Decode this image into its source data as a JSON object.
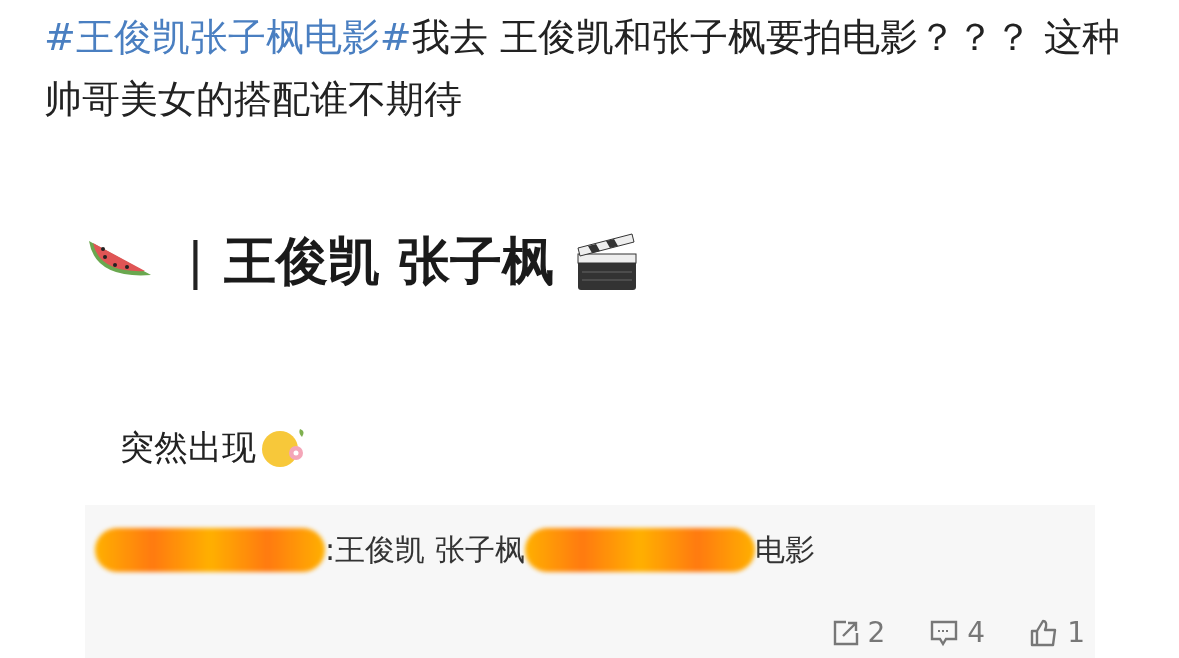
{
  "post": {
    "hashtag": "#王俊凯张子枫电影#",
    "text": "我去 王俊凯和张子枫要拍电影？？？ 这种帅哥美女的搭配谁不期待"
  },
  "image": {
    "separator": "|",
    "title": "王俊凯 张子枫"
  },
  "quote": {
    "text": "突然出现"
  },
  "repost": {
    "segments": [
      {
        "kind": "redacted"
      },
      {
        "kind": "text",
        "text": ":王俊凯 张子枫"
      },
      {
        "kind": "redacted"
      },
      {
        "kind": "text",
        "text": "电影"
      }
    ]
  },
  "actions": [
    {
      "kind": "share",
      "count": "2"
    },
    {
      "kind": "comment",
      "count": "4"
    },
    {
      "kind": "like",
      "count": "1"
    }
  ]
}
